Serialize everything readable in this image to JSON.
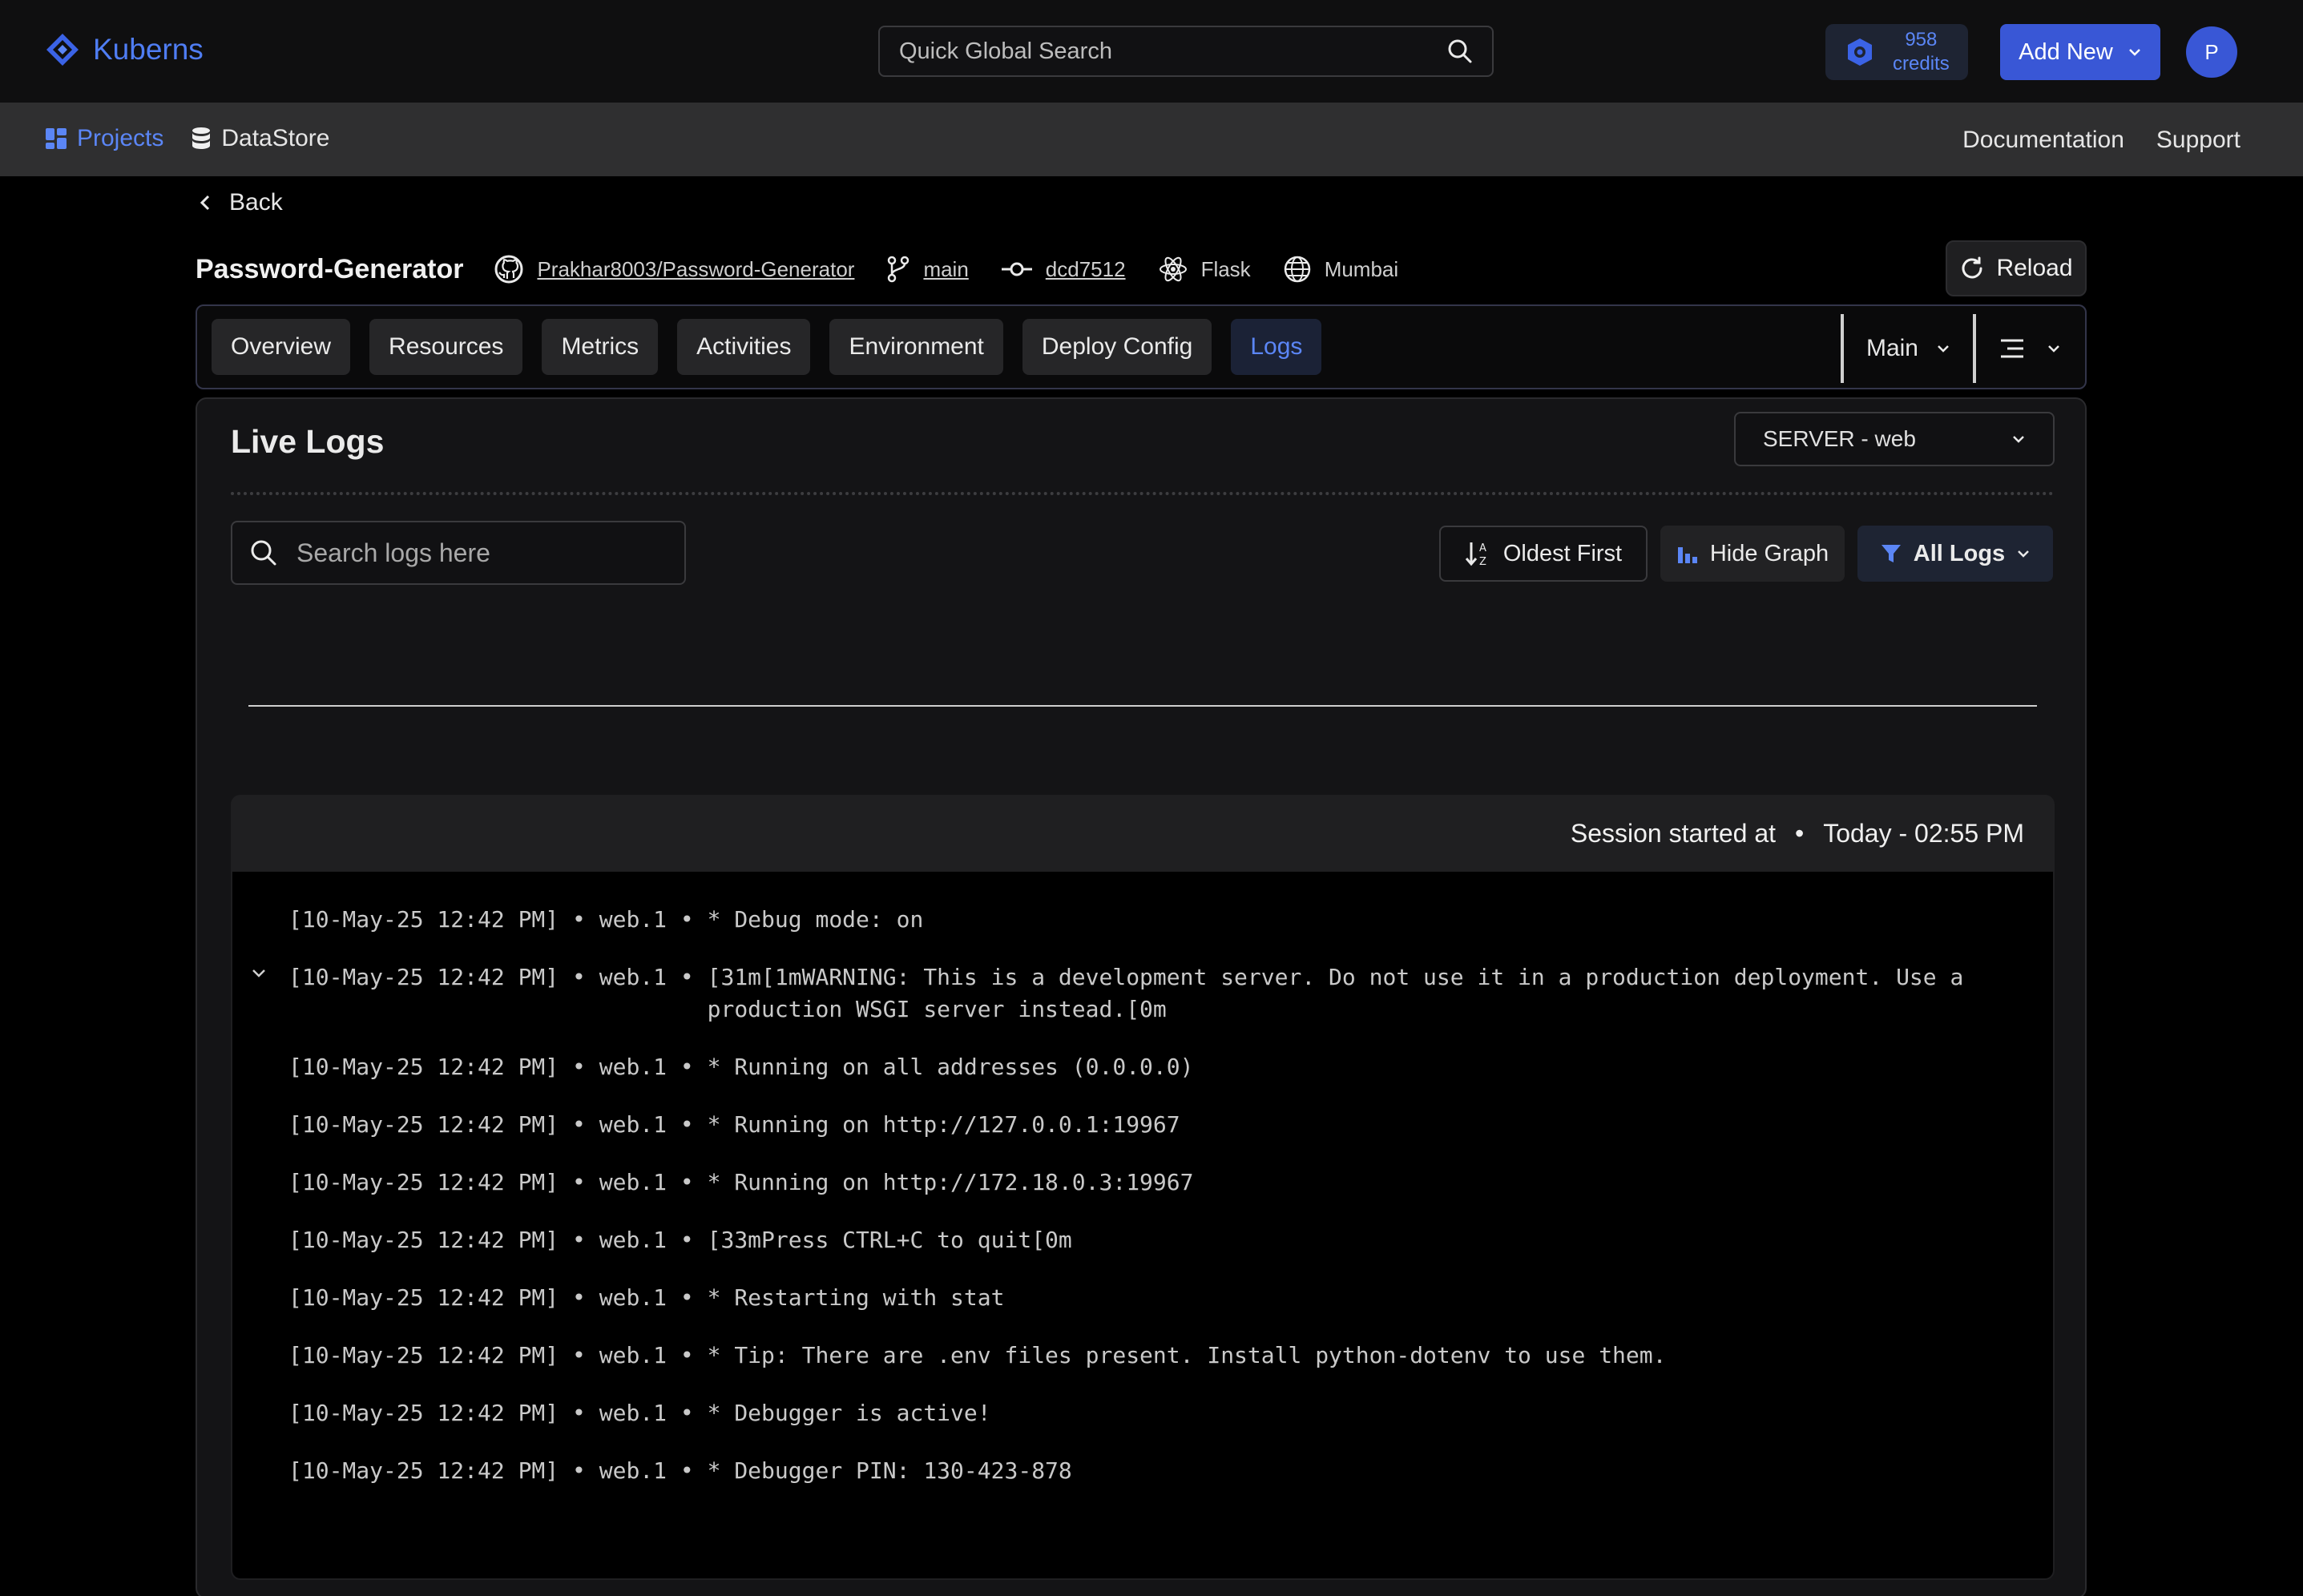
{
  "topbar": {
    "brand": "Kuberns",
    "search_placeholder": "Quick Global Search",
    "credits_value": "958",
    "credits_label": "credits",
    "add_new_label": "Add New",
    "avatar_initial": "P"
  },
  "nav": {
    "projects": "Projects",
    "datastore": "DataStore",
    "documentation": "Documentation",
    "support": "Support"
  },
  "back_label": "Back",
  "project": {
    "name": "Password-Generator",
    "repo": "Prakhar8003/Password-Generator",
    "branch": "main",
    "commit": "dcd7512",
    "framework": "Flask",
    "region": "Mumbai",
    "reload_label": "Reload"
  },
  "tabs": [
    "Overview",
    "Resources",
    "Metrics",
    "Activities",
    "Environment",
    "Deploy Config",
    "Logs"
  ],
  "active_tab": "Logs",
  "branch_select": "Main",
  "logs": {
    "title": "Live Logs",
    "server_select": "SERVER - web",
    "search_placeholder": "Search logs here",
    "sort_label": "Oldest First",
    "graph_label": "Hide Graph",
    "filter_label": "All Logs",
    "session_label": "Session started at",
    "session_time": "Today - 02:55 PM",
    "lines": [
      {
        "ts": "[10-May-25 12:42 PM]",
        "src": "web.1",
        "msg": "* Debug mode: on"
      },
      {
        "ts": "[10-May-25 12:42 PM]",
        "src": "web.1",
        "msg": "[31m[1mWARNING: This is a development server. Do not use it in a production deployment. Use a production WSGI server instead.[0m",
        "expandable": true
      },
      {
        "ts": "[10-May-25 12:42 PM]",
        "src": "web.1",
        "msg": "* Running on all addresses (0.0.0.0)"
      },
      {
        "ts": "[10-May-25 12:42 PM]",
        "src": "web.1",
        "msg": "* Running on http://127.0.0.1:19967"
      },
      {
        "ts": "[10-May-25 12:42 PM]",
        "src": "web.1",
        "msg": "* Running on http://172.18.0.3:19967"
      },
      {
        "ts": "[10-May-25 12:42 PM]",
        "src": "web.1",
        "msg": "[33mPress CTRL+C to quit[0m"
      },
      {
        "ts": "[10-May-25 12:42 PM]",
        "src": "web.1",
        "msg": "* Restarting with stat"
      },
      {
        "ts": "[10-May-25 12:42 PM]",
        "src": "web.1",
        "msg": "* Tip: There are .env files present. Install python-dotenv to use them."
      },
      {
        "ts": "[10-May-25 12:42 PM]",
        "src": "web.1",
        "msg": "* Debugger is active!"
      },
      {
        "ts": "[10-May-25 12:42 PM]",
        "src": "web.1",
        "msg": "* Debugger PIN: 130-423-878"
      }
    ]
  },
  "colors": {
    "accent": "#3957d6",
    "accent_text": "#5b86f6",
    "background": "#000000"
  }
}
